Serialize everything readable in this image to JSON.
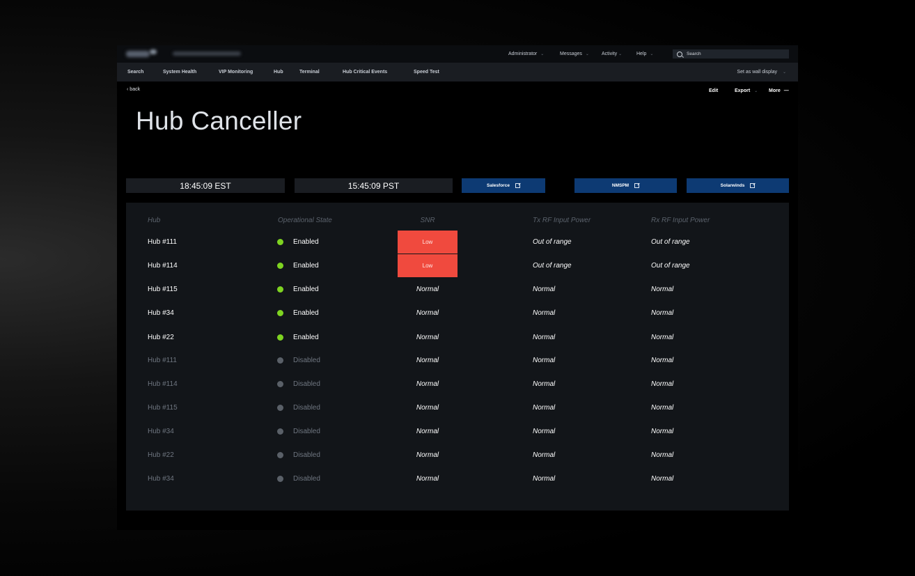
{
  "topbar": {
    "nav": [
      {
        "label": "Administrator",
        "has_caret": true
      },
      {
        "label": "Messages",
        "has_caret": true
      },
      {
        "label": "Activity",
        "has_caret": true
      },
      {
        "label": "Help",
        "has_caret": true
      }
    ],
    "search_placeholder": "Search"
  },
  "subnav": {
    "tabs": [
      "Search",
      "System Health",
      "VIP Monitoring",
      "Hub",
      "Terminal",
      "Hub Critical Events",
      "Speed Test"
    ],
    "wall_display": "Set as wall display"
  },
  "page": {
    "back": "back",
    "title": "Hub Canceller",
    "actions": {
      "edit": "Edit",
      "export": "Export",
      "more": "More"
    }
  },
  "clocks": {
    "est": "18:45:09 EST",
    "pst": "15:45:09 PST"
  },
  "links": {
    "salesforce": "Salesforce",
    "nmspm": "NMSPM",
    "solarwinds": "Solarwinds"
  },
  "table": {
    "headers": {
      "hub": "Hub",
      "state": "Operational State",
      "snr": "SNR",
      "tx": "Tx RF Input Power",
      "rx": "Rx RF Input Power"
    },
    "rows": [
      {
        "hub": "Hub #111",
        "state": "Enabled",
        "enabled": true,
        "snr": "Low",
        "snr_alert": true,
        "tx": "Out of range",
        "rx": "Out of range"
      },
      {
        "hub": "Hub #114",
        "state": "Enabled",
        "enabled": true,
        "snr": "Low",
        "snr_alert": true,
        "tx": "Out of range",
        "rx": "Out of range"
      },
      {
        "hub": "Hub #115",
        "state": "Enabled",
        "enabled": true,
        "snr": "Normal",
        "snr_alert": false,
        "tx": "Normal",
        "rx": "Normal"
      },
      {
        "hub": "Hub #34",
        "state": "Enabled",
        "enabled": true,
        "snr": "Normal",
        "snr_alert": false,
        "tx": "Normal",
        "rx": "Normal"
      },
      {
        "hub": "Hub #22",
        "state": "Enabled",
        "enabled": true,
        "snr": "Normal",
        "snr_alert": false,
        "tx": "Normal",
        "rx": "Normal"
      },
      {
        "hub": "Hub #111",
        "state": "Disabled",
        "enabled": false,
        "snr": "Normal",
        "snr_alert": false,
        "tx": "Normal",
        "rx": "Normal"
      },
      {
        "hub": "Hub #114",
        "state": "Disabled",
        "enabled": false,
        "snr": "Normal",
        "snr_alert": false,
        "tx": "Normal",
        "rx": "Normal"
      },
      {
        "hub": "Hub #115",
        "state": "Disabled",
        "enabled": false,
        "snr": "Normal",
        "snr_alert": false,
        "tx": "Normal",
        "rx": "Normal"
      },
      {
        "hub": "Hub #34",
        "state": "Disabled",
        "enabled": false,
        "snr": "Normal",
        "snr_alert": false,
        "tx": "Normal",
        "rx": "Normal"
      },
      {
        "hub": "Hub #22",
        "state": "Disabled",
        "enabled": false,
        "snr": "Normal",
        "snr_alert": false,
        "tx": "Normal",
        "rx": "Normal"
      },
      {
        "hub": "Hub #34",
        "state": "Disabled",
        "enabled": false,
        "snr": "Normal",
        "snr_alert": false,
        "tx": "Normal",
        "rx": "Normal"
      }
    ]
  },
  "colors": {
    "status_enabled": "#7ed321",
    "status_disabled": "#5a6068",
    "snr_alert": "#f04a3e",
    "link_button": "#0d3a73"
  },
  "icons": {
    "logo": "logo",
    "caret": "chevron-down-icon",
    "search": "search-icon",
    "back": "chevron-left-icon",
    "more": "more-icon",
    "external": "external-link-icon",
    "status": "status-dot-icon"
  }
}
